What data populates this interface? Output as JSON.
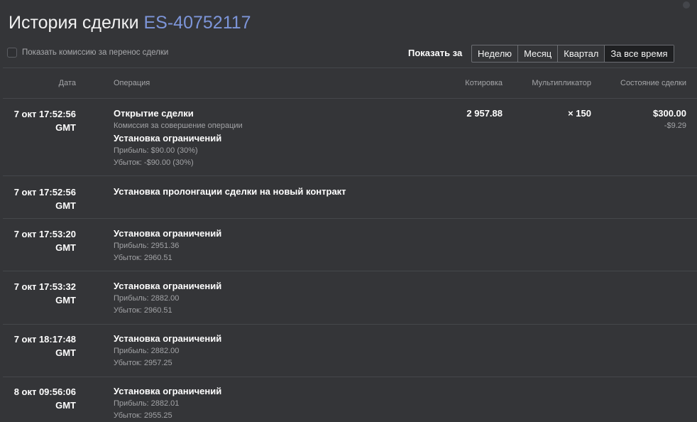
{
  "title": {
    "text": "История сделки",
    "deal_id": "ES-40752117"
  },
  "commission_toggle": {
    "label": "Показать комиссию за перенос сделки",
    "checked": false
  },
  "period": {
    "label": "Показать за",
    "buttons": [
      "Неделю",
      "Месяц",
      "Квартал",
      "За все время"
    ],
    "active": "За все время"
  },
  "columns": {
    "date": "Дата",
    "operation": "Операция",
    "quote": "Котировка",
    "multiplier": "Мультипликатор",
    "state": "Состояние сделки"
  },
  "rows": [
    {
      "date": "7 окт 17:52:56",
      "tz": "GMT",
      "ops": [
        {
          "title": "Открытие сделки",
          "subs": [
            "Комиссия за совершение операции"
          ]
        },
        {
          "title": "Установка ограничений",
          "subs": [
            "Прибыль: $90.00 (30%)",
            "Убыток: -$90.00 (30%)"
          ]
        }
      ],
      "quote": "2 957.88",
      "multiplier": "× 150",
      "state": "$300.00",
      "fee": "-$9.29"
    },
    {
      "date": "7 окт 17:52:56",
      "tz": "GMT",
      "ops": [
        {
          "title": "Установка пролонгации сделки на новый контракт",
          "subs": []
        }
      ]
    },
    {
      "date": "7 окт 17:53:20",
      "tz": "GMT",
      "ops": [
        {
          "title": "Установка ограничений",
          "subs": [
            "Прибыль: 2951.36",
            "Убыток: 2960.51"
          ]
        }
      ]
    },
    {
      "date": "7 окт 17:53:32",
      "tz": "GMT",
      "ops": [
        {
          "title": "Установка ограничений",
          "subs": [
            "Прибыль: 2882.00",
            "Убыток: 2960.51"
          ]
        }
      ]
    },
    {
      "date": "7 окт 18:17:48",
      "tz": "GMT",
      "ops": [
        {
          "title": "Установка ограничений",
          "subs": [
            "Прибыль: 2882.00",
            "Убыток: 2957.25"
          ]
        }
      ]
    },
    {
      "date": "8 окт 09:56:06",
      "tz": "GMT",
      "ops": [
        {
          "title": "Установка ограничений",
          "subs": [
            "Прибыль: 2882.01",
            "Убыток: 2955.25"
          ]
        }
      ]
    }
  ]
}
